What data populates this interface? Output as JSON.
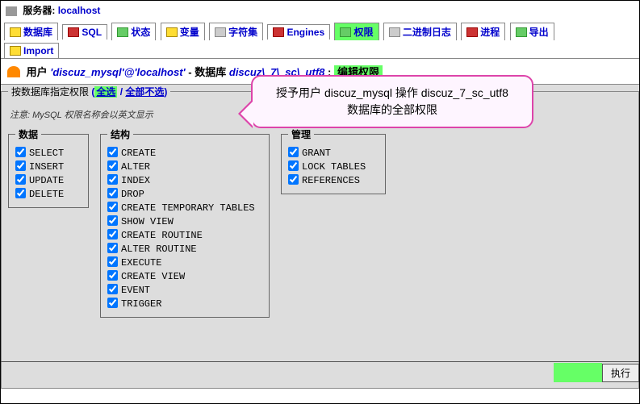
{
  "server": {
    "label": "服务器:",
    "host": "localhost"
  },
  "tabs": {
    "row1": [
      {
        "name": "db",
        "label": "数据库"
      },
      {
        "name": "sql",
        "label": "SQL"
      },
      {
        "name": "status",
        "label": "状态"
      },
      {
        "name": "var",
        "label": "变量"
      },
      {
        "name": "charset",
        "label": "字符集"
      },
      {
        "name": "engines",
        "label": "Engines"
      },
      {
        "name": "priv",
        "label": "权限"
      },
      {
        "name": "binlog",
        "label": "二进制日志"
      },
      {
        "name": "process",
        "label": "进程"
      },
      {
        "name": "export",
        "label": "导出"
      }
    ],
    "row2": [
      {
        "name": "import",
        "label": "Import"
      }
    ]
  },
  "title": {
    "user_label": "用户",
    "user_value": "'discuz_mysql'@'localhost'",
    "sep": "-",
    "db_label": "数据库",
    "db_value": "discuz\\_7\\_sc\\_utf8",
    "colon": ":",
    "edit": "编辑权限"
  },
  "selector": {
    "label": "按数据库指定权限",
    "all": "全选",
    "none": "全部不选",
    "open": "(",
    "slash": " / ",
    "close": ")"
  },
  "note": "注意: MySQL 权限名称会以英文显示",
  "groups": {
    "data": {
      "legend": "数据",
      "items": [
        "SELECT",
        "INSERT",
        "UPDATE",
        "DELETE"
      ]
    },
    "struct": {
      "legend": "结构",
      "items": [
        "CREATE",
        "ALTER",
        "INDEX",
        "DROP",
        "CREATE TEMPORARY TABLES",
        "SHOW VIEW",
        "CREATE ROUTINE",
        "ALTER ROUTINE",
        "EXECUTE",
        "CREATE VIEW",
        "EVENT",
        "TRIGGER"
      ]
    },
    "admin": {
      "legend": "管理",
      "items": [
        "GRANT",
        "LOCK TABLES",
        "REFERENCES"
      ]
    }
  },
  "callout": {
    "line1_a": "授予用户 ",
    "line1_b": "discuz_mysql",
    "line1_c": " 操作 ",
    "line1_d": "discuz_7_sc_utf8",
    "line2": "数据库的全部权限"
  },
  "exec": "执行"
}
